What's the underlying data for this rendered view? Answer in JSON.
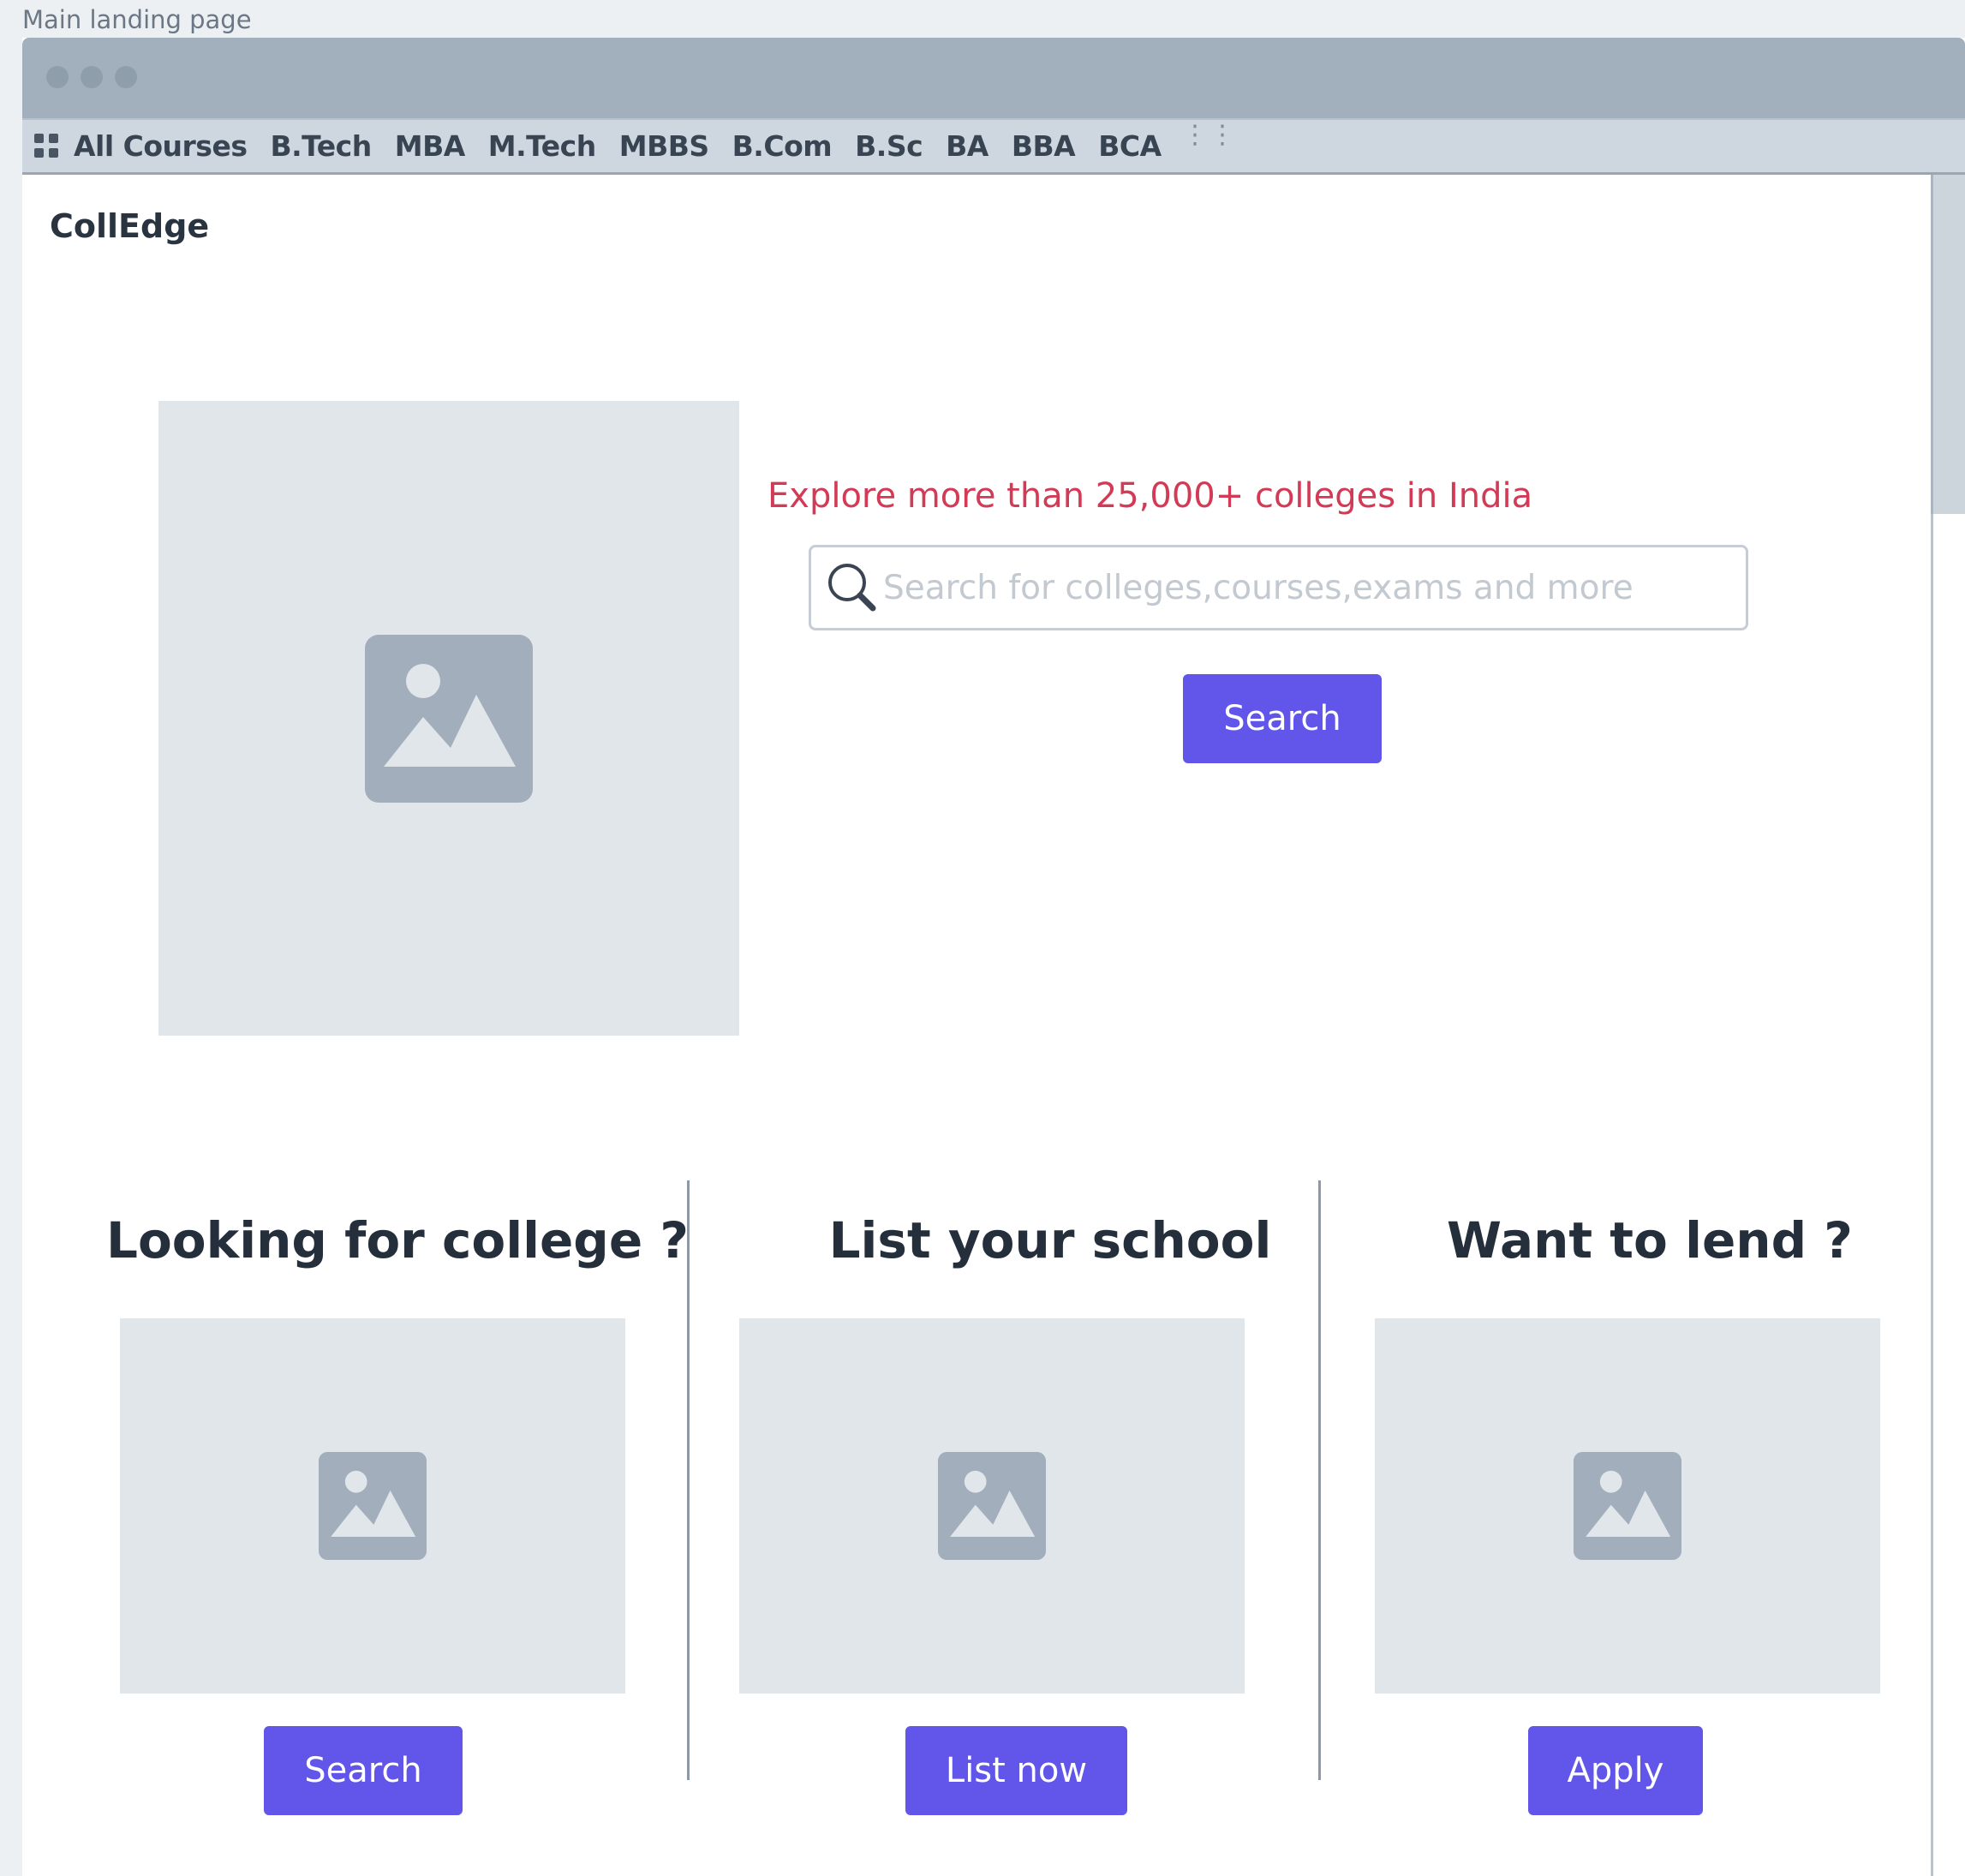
{
  "frame_label": "Main landing page",
  "nav": {
    "items": [
      "All Courses",
      "B.Tech",
      "MBA",
      "M.Tech",
      "MBBS",
      "B.Com",
      "B.Sc",
      "BA",
      "BBA",
      "BCA"
    ],
    "more": "⋮⋮"
  },
  "brand": "CollEdge",
  "hero": {
    "tagline": "Explore more than 25,000+ colleges in India",
    "search_placeholder": "Search for colleges,courses,exams and more",
    "search_button": "Search"
  },
  "columns": [
    {
      "title": "Looking for college ?",
      "button": "Search"
    },
    {
      "title": "List your school",
      "button": "List now"
    },
    {
      "title": "Want to lend ?",
      "button": "Apply"
    }
  ],
  "colors": {
    "accent": "#6155ea",
    "tagline": "#d33a55",
    "placeholder_bg": "#e1e6eb",
    "titlebar": "#a2b0bd"
  },
  "icons": [
    "grid-icon",
    "search-icon",
    "image-placeholder-icon"
  ]
}
